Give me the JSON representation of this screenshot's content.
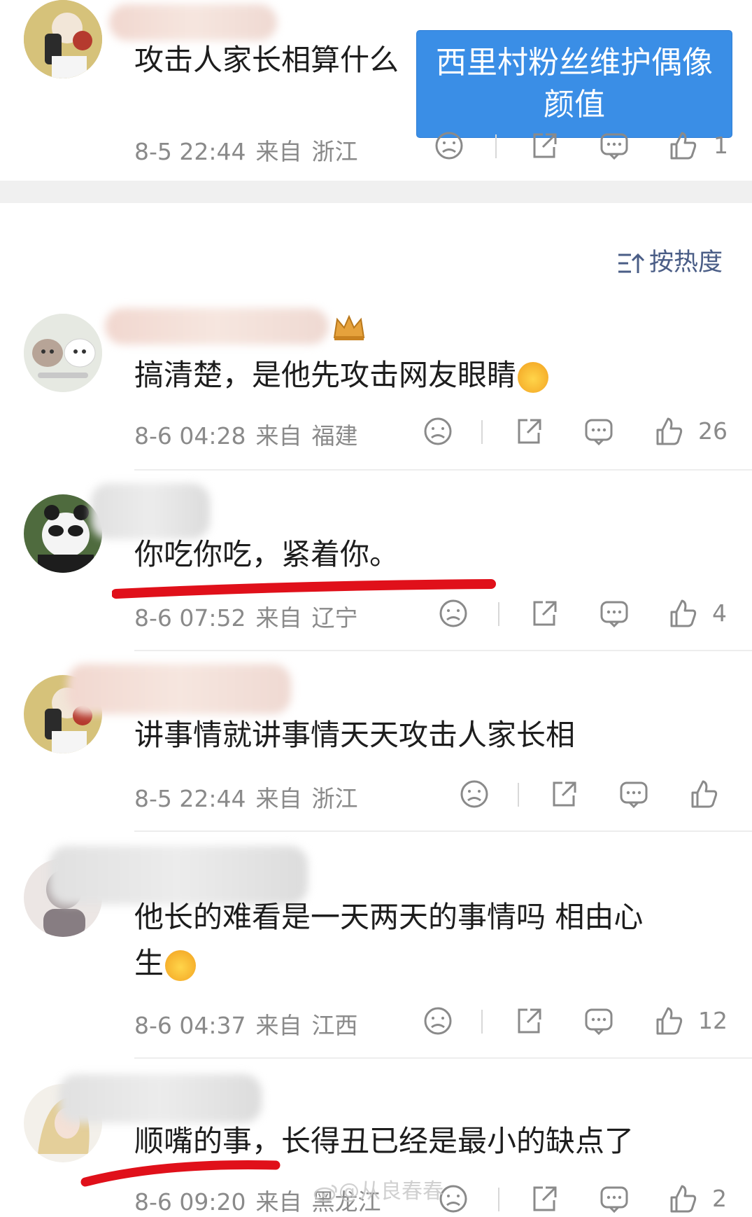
{
  "overlay_caption": "西里村粉丝维护偶像颜值",
  "sort_label": "按热度",
  "watermark": "@从良春春",
  "comments": [
    {
      "text": "攻击人家长相算什么",
      "date": "8-5 22:44",
      "from": "来自",
      "region": "浙江",
      "likes": "1"
    },
    {
      "text": "搞清楚，是他先攻击网友眼睛",
      "date": "8-6 04:28",
      "from": "来自",
      "region": "福建",
      "likes": "26"
    },
    {
      "text": "你吃你吃，紧着你。",
      "date": "8-6 07:52",
      "from": "来自",
      "region": "辽宁",
      "likes": "4"
    },
    {
      "text": "讲事情就讲事情天天攻击人家长相",
      "date": "8-5 22:44",
      "from": "来自",
      "region": "浙江",
      "likes": ""
    },
    {
      "text": "他长的难看是一天两天的事情吗 相由心",
      "text2": "生",
      "date": "8-6 04:37",
      "from": "来自",
      "region": "江西",
      "likes": "12"
    },
    {
      "text": "顺嘴的事，长得丑已经是最小的缺点了",
      "date": "8-6 09:20",
      "from": "来自",
      "region": "黑龙江",
      "likes": "2"
    }
  ],
  "icons": [
    "dislike-icon",
    "share-icon",
    "comment-icon",
    "like-icon",
    "sort-icon"
  ],
  "colors": {
    "overlay": "#3a8ee6",
    "underline": "#e0101a",
    "meta": "#8a8a8a",
    "sort": "#4a5d86"
  }
}
